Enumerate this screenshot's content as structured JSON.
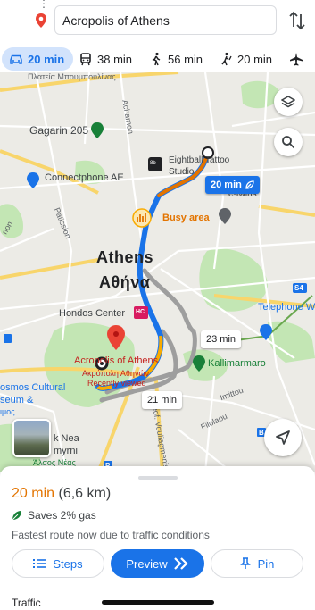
{
  "search": {
    "destination": "Acropolis of Athens"
  },
  "modes": [
    {
      "icon": "car-icon",
      "label": "20 min",
      "active": true
    },
    {
      "icon": "transit-icon",
      "label": "38 min",
      "active": false
    },
    {
      "icon": "walk-icon",
      "label": "56 min",
      "active": false
    },
    {
      "icon": "rideshare-icon",
      "label": "20 min",
      "active": false
    },
    {
      "icon": "flight-icon",
      "label": "",
      "active": false
    }
  ],
  "map": {
    "city_name": "Athens",
    "city_name_greek": "Αθήνα",
    "labels": {
      "platia": "Πλατεία Μπουμπουλίνας",
      "acharnon": "Acharnon",
      "gagarin": "Gagarin 205",
      "connectphone": "Connectphone AE",
      "eightball_1": "Eightball Tattoo",
      "eightball_2": "Studio",
      "etwins": "e-twins",
      "busy_area": "Busy area",
      "patision": "Patission",
      "hondos": "Hondos Center",
      "acropolis": "Acropolis of Athens",
      "acropolis_gr": "Ακρόπολη Αθηνών",
      "recently_viewed": "Recently viewed",
      "kallimarmaro": "Kallimarmaro",
      "telephone": "Telephone We",
      "imittou": "Imittou",
      "filolaou": "Filolaou",
      "vouliagmenis": "Leof. Vouliagmenis",
      "cultural_1": "osmos Cultural",
      "cultural_2": "seum &",
      "cultural_3": "ιμος",
      "nea_1": "k Nea",
      "nea_2": "myrni",
      "nea_3": "Άλσος Νέας",
      "road_s4": "S4",
      "road_p": "P",
      "road_b": "B",
      "road_nou": "non",
      "road_hc": "HC"
    },
    "route_times": {
      "primary": "20 min",
      "alt1": "23 min",
      "alt2": "21 min"
    }
  },
  "sheet": {
    "eta_time": "20 min",
    "eta_distance": "(6,6 km)",
    "savings": "Saves 2% gas",
    "reason": "Fastest route now due to traffic conditions",
    "buttons": {
      "steps": "Steps",
      "preview": "Preview",
      "pin": "Pin"
    },
    "traffic_heading": "Traffic"
  },
  "colors": {
    "accent": "#1a73e8",
    "route_orange": "#e37400",
    "route_alt": "#9e9e9e",
    "pin_red": "#ea4335",
    "park_green": "#c3e6b4"
  }
}
